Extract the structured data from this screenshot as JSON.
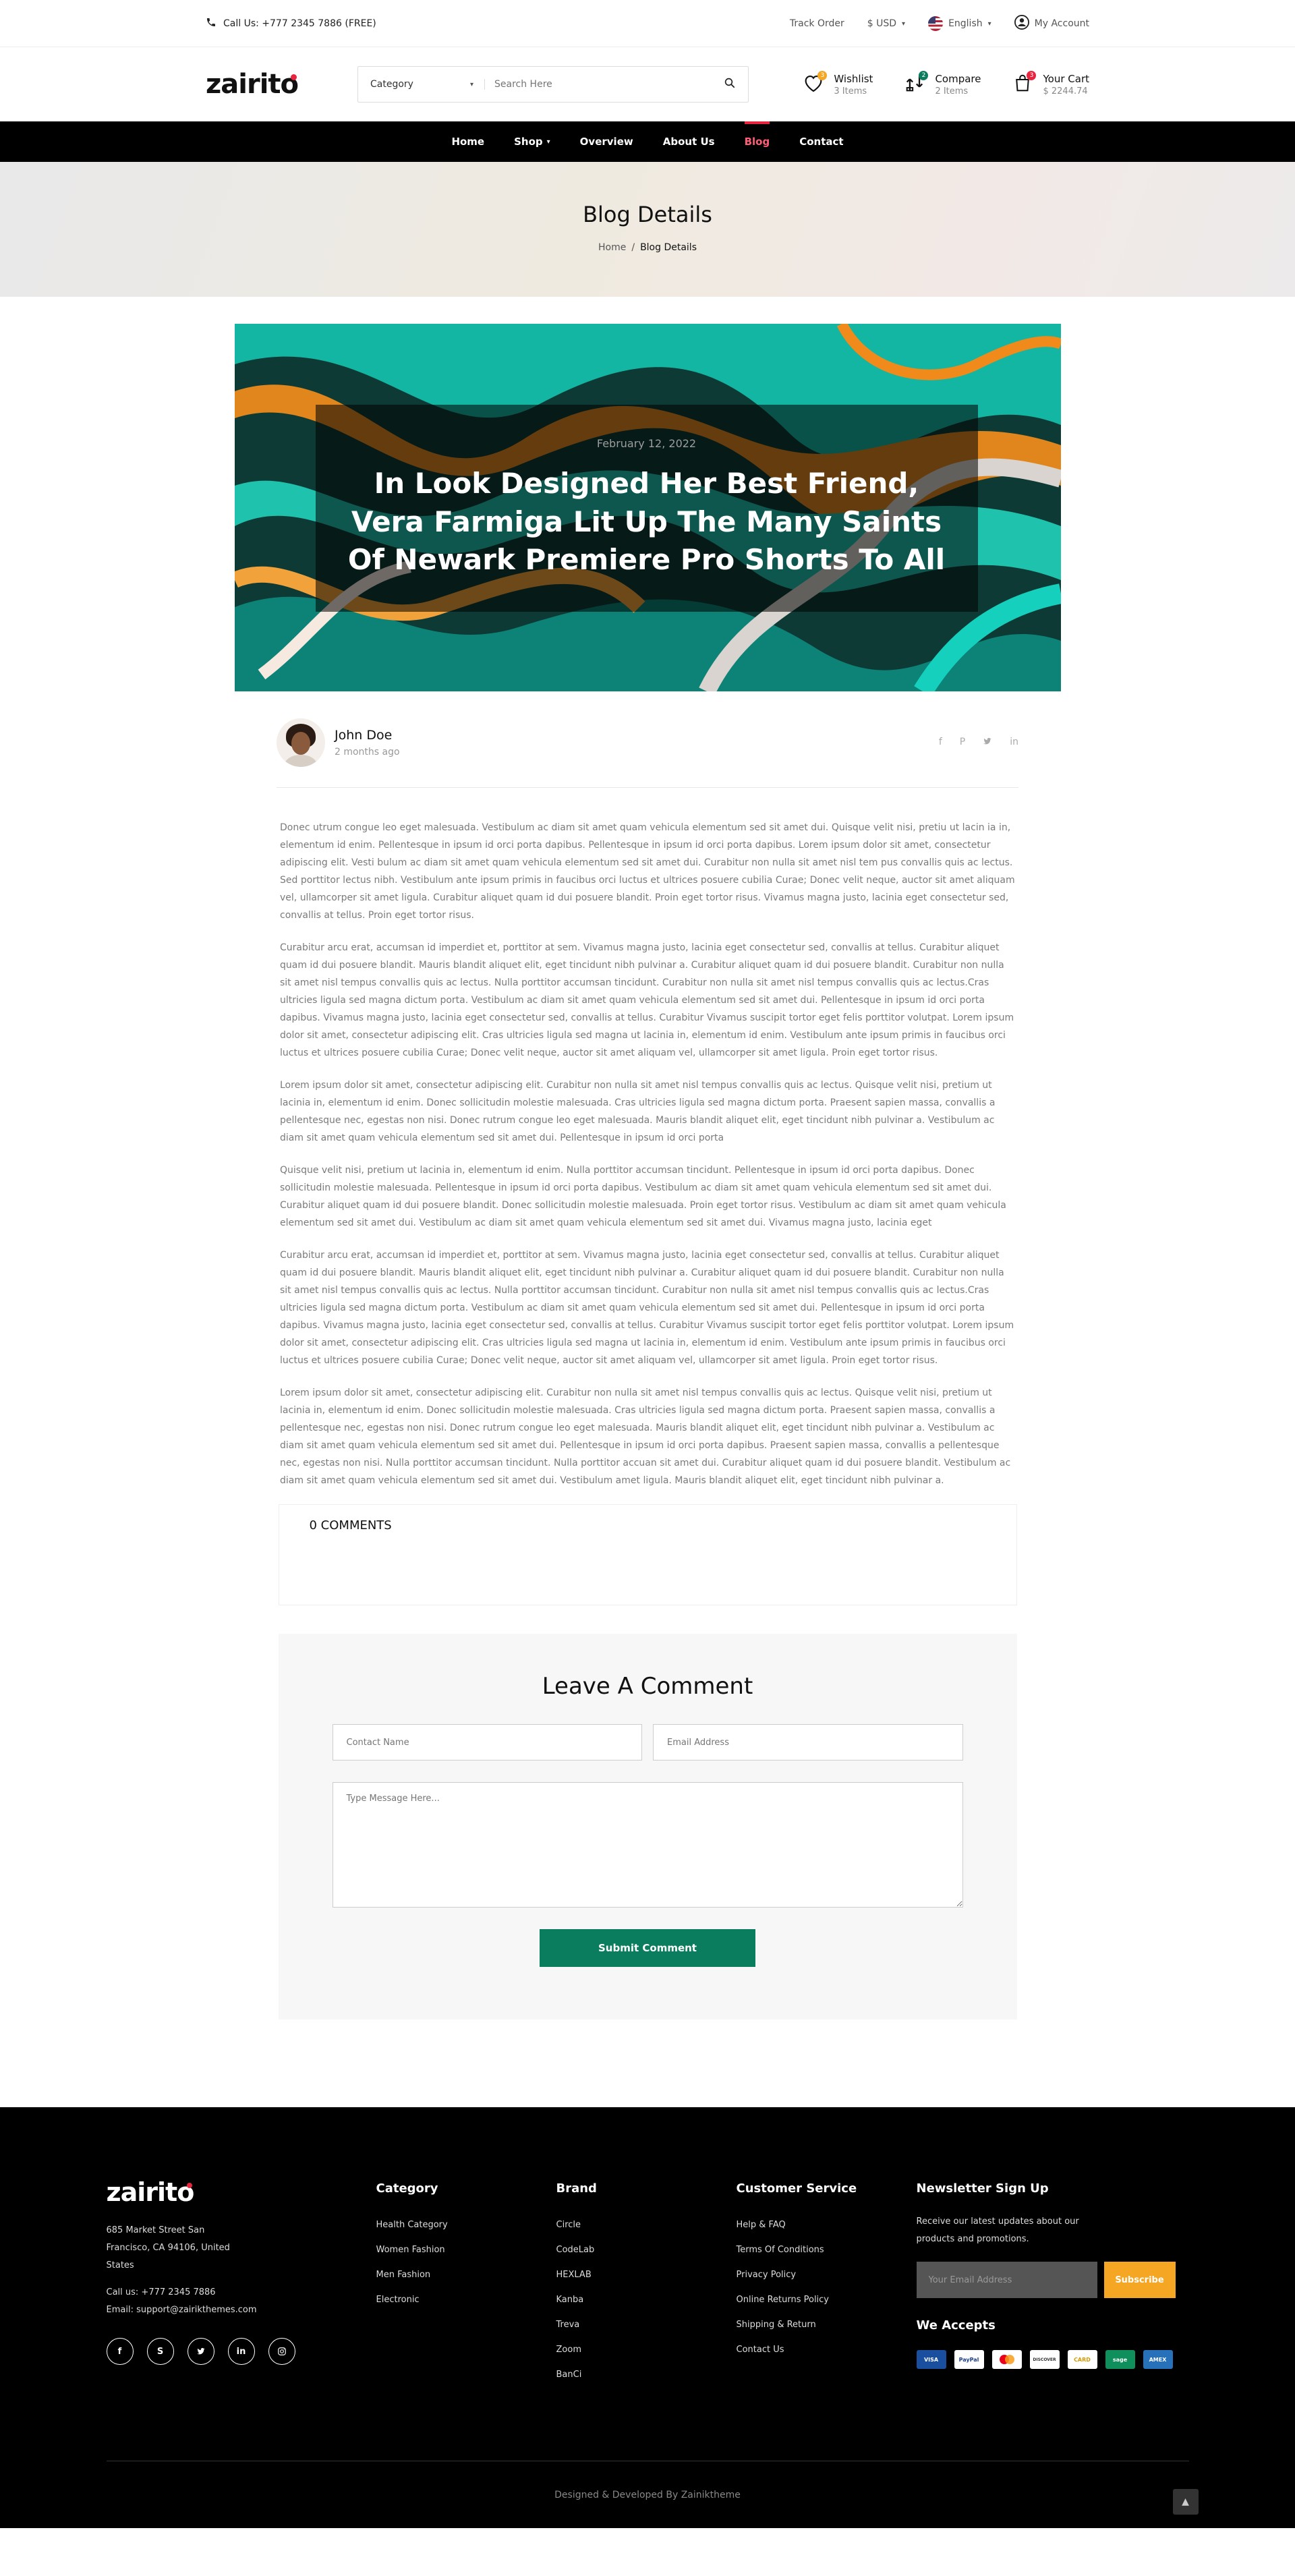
{
  "topbar": {
    "phone": "Call Us: +777 2345 7886 (FREE)",
    "track_order": "Track Order",
    "currency": "$ USD",
    "language": "English",
    "account": "My Account"
  },
  "header": {
    "logo": "zairito",
    "search_category": "Category",
    "search_placeholder": "Search Here",
    "wishlist_label": "Wishlist",
    "wishlist_count": "3 Items",
    "wishlist_badge": "3",
    "compare_label": "Compare",
    "compare_count": "2 Items",
    "compare_badge": "2",
    "cart_label": "Your Cart",
    "cart_total": "$ 2244.74",
    "cart_badge": "3"
  },
  "nav": {
    "items": [
      "Home",
      "Shop",
      "Overview",
      "About Us",
      "Blog",
      "Contact"
    ],
    "active": "Blog"
  },
  "banner": {
    "title": "Blog Details",
    "crumb_home": "Home",
    "crumb_sep": "/",
    "crumb_current": "Blog Details"
  },
  "post": {
    "date": "February 12, 2022",
    "title": "In Look Designed Her Best Friend, Vera Farmiga Lit Up The Many Saints Of Newark Premiere Pro Shorts To All",
    "author": "John Doe",
    "time_ago": "2 months ago",
    "share_icons": [
      "facebook-icon",
      "pinterest-icon",
      "twitter-icon",
      "linkedin-icon"
    ],
    "paragraphs": [
      "Donec utrum congue leo eget malesuada. Vestibulum ac diam sit amet quam vehicula elementum sed sit amet dui. Quisque velit nisi, pretiu ut lacin ia in, elementum id enim. Pellentesque in ipsum id orci porta dapibus. Pellentesque in ipsum id orci porta dapibus. Lorem ipsum dolor sit amet, consectetur adipiscing elit. Vesti bulum ac diam sit amet quam vehicula elementum sed sit amet dui. Curabitur non nulla sit amet nisl tem pus convallis quis ac lectus. Sed porttitor lectus nibh. Vestibulum ante ipsum primis in faucibus orci luctus et ultrices posuere cubilia Curae; Donec velit neque, auctor sit amet aliquam vel, ullamcorper sit amet ligula. Curabitur aliquet quam id dui posuere blandit. Proin eget tortor risus. Vivamus magna justo, lacinia eget consectetur sed, convallis at tellus. Proin eget tortor risus.",
      "Curabitur arcu erat, accumsan id imperdiet et, porttitor at sem. Vivamus magna justo, lacinia eget consectetur sed, convallis at tellus. Curabitur aliquet quam id dui posuere blandit. Mauris blandit aliquet elit, eget tincidunt nibh pulvinar a. Curabitur aliquet quam id dui posuere blandit. Curabitur non nulla sit amet nisl tempus convallis quis ac lectus. Nulla porttitor accumsan tincidunt. Curabitur non nulla sit amet nisl tempus convallis quis ac lectus.Cras ultricies ligula sed magna dictum porta. Vestibulum ac diam sit amet quam vehicula elementum sed sit amet dui. Pellentesque in ipsum id orci porta dapibus. Vivamus magna justo, lacinia eget consectetur sed, convallis at tellus. Curabitur Vivamus suscipit tortor eget felis porttitor volutpat. Lorem ipsum dolor sit amet, consectetur adipiscing elit. Cras ultricies ligula sed magna ut lacinia in, elementum id enim. Vestibulum ante ipsum primis in faucibus orci luctus et ultrices posuere cubilia Curae; Donec velit neque, auctor sit amet aliquam vel, ullamcorper sit amet ligula. Proin eget tortor risus.",
      "Lorem ipsum dolor sit amet, consectetur adipiscing elit. Curabitur non nulla sit amet nisl tempus convallis quis ac lectus. Quisque velit nisi, pretium ut lacinia in, elementum id enim. Donec sollicitudin molestie malesuada. Cras ultricies ligula sed magna dictum porta. Praesent sapien massa, convallis a pellentesque nec, egestas non nisi. Donec rutrum congue leo eget malesuada. Mauris blandit aliquet elit, eget tincidunt nibh pulvinar a. Vestibulum ac diam sit amet quam vehicula elementum sed sit amet dui. Pellentesque in ipsum id orci porta",
      "Quisque velit nisi, pretium ut lacinia in, elementum id enim. Nulla porttitor accumsan tincidunt. Pellentesque in ipsum id orci porta dapibus. Donec sollicitudin molestie malesuada. Pellentesque in ipsum id orci porta dapibus. Vestibulum ac diam sit amet quam vehicula elementum sed sit amet dui. Curabitur aliquet quam id dui posuere blandit. Donec sollicitudin molestie malesuada. Proin eget tortor risus. Vestibulum ac diam sit amet quam vehicula elementum sed sit amet dui. Vestibulum ac diam sit amet quam vehicula elementum sed sit amet dui. Vivamus magna justo, lacinia eget",
      "Curabitur arcu erat, accumsan id imperdiet et, porttitor at sem. Vivamus magna justo, lacinia eget consectetur sed, convallis at tellus. Curabitur aliquet quam id dui posuere blandit. Mauris blandit aliquet elit, eget tincidunt nibh pulvinar a. Curabitur aliquet quam id dui posuere blandit. Curabitur non nulla sit amet nisl tempus convallis quis ac lectus. Nulla porttitor accumsan tincidunt. Curabitur non nulla sit amet nisl tempus convallis quis ac lectus.Cras ultricies ligula sed magna dictum porta. Vestibulum ac diam sit amet quam vehicula elementum sed sit amet dui. Pellentesque in ipsum id orci porta dapibus. Vivamus magna justo, lacinia eget consectetur sed, convallis at tellus. Curabitur Vivamus suscipit tortor eget felis porttitor volutpat. Lorem ipsum dolor sit amet, consectetur adipiscing elit. Cras ultricies ligula sed magna ut lacinia in, elementum id enim. Vestibulum ante ipsum primis in faucibus orci luctus et ultrices posuere cubilia Curae; Donec velit neque, auctor sit amet aliquam vel, ullamcorper sit amet ligula. Proin eget tortor risus.",
      "Lorem ipsum dolor sit amet, consectetur adipiscing elit. Curabitur non nulla sit amet nisl tempus convallis quis ac lectus. Quisque velit nisi, pretium ut lacinia in, elementum id enim. Donec sollicitudin molestie malesuada. Cras ultricies ligula sed magna dictum porta. Praesent sapien massa, convallis a pellentesque nec, egestas non nisi. Donec rutrum congue leo eget malesuada. Mauris blandit aliquet elit, eget tincidunt nibh pulvinar a. Vestibulum ac diam sit amet quam vehicula elementum sed sit amet dui. Pellentesque in ipsum id orci porta dapibus. Praesent sapien massa, convallis a pellentesque nec, egestas non nisi. Nulla porttitor accumsan tincidunt. Nulla porttitor accuan sit amet dui. Curabitur aliquet quam id dui posuere blandit. Vestibulum ac diam sit amet quam vehicula elementum sed sit amet dui. Vestibulum amet ligula. Mauris blandit aliquet elit, eget tincidunt nibh pulvinar a."
    ]
  },
  "comments": {
    "count_label": "0 COMMENTS"
  },
  "leave_comment": {
    "title": "Leave A Comment",
    "name_placeholder": "Contact Name",
    "email_placeholder": "Email Address",
    "message_placeholder": "Type Message Here...",
    "submit_label": "Submit Comment"
  },
  "footer": {
    "logo": "zairito",
    "address": "685 Market Street San Francisco, CA 94106, United States",
    "phone": "Call us: +777 2345 7886",
    "email": "Email: support@zairikthemes.com",
    "socials": [
      "facebook-icon",
      "skype-icon",
      "twitter-icon",
      "linkedin-icon",
      "instagram-icon"
    ],
    "columns": [
      {
        "title": "Category",
        "items": [
          "Health Category",
          "Women Fashion",
          "Men Fashion",
          "Electronic"
        ]
      },
      {
        "title": "Brand",
        "items": [
          "Circle",
          "CodeLab",
          "HEXLAB",
          "Kanba",
          "Treva",
          "Zoom",
          "BanCi"
        ]
      },
      {
        "title": "Customer Service",
        "items": [
          "Help & FAQ",
          "Terms Of Conditions",
          "Privacy Policy",
          "Online Returns Policy",
          "Shipping & Return",
          "Contact Us"
        ]
      }
    ],
    "newsletter_title": "Newsletter Sign Up",
    "newsletter_desc": "Receive our latest updates about our products and promotions.",
    "newsletter_placeholder": "Your Email Address",
    "subscribe_label": "Subscribe",
    "we_accept": "We Accepts",
    "cards": [
      "VISA",
      "PayPal",
      "MC",
      "DISCOVER",
      "CARD",
      "sage",
      "AMEX"
    ],
    "copyright": "Designed & Developed By Zainiktheme"
  },
  "colors": {
    "accent_red": "#e8253e",
    "submit_green": "#0b7d5f",
    "subscribe_orange": "#f5a623"
  }
}
